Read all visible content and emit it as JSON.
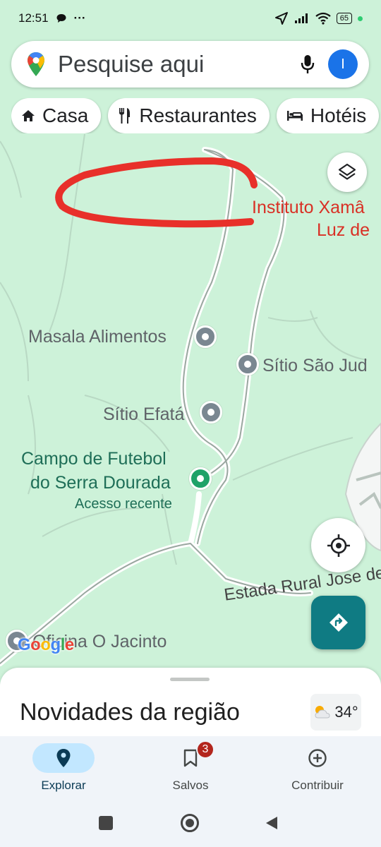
{
  "status_bar": {
    "time": "12:51",
    "dots": "···",
    "battery": "65"
  },
  "search": {
    "placeholder": "Pesquise aqui",
    "avatar_letter": "I"
  },
  "chips": [
    {
      "label": "Casa",
      "icon": "home-icon"
    },
    {
      "label": "Restaurantes",
      "icon": "restaurant-icon"
    },
    {
      "label": "Hotéis",
      "icon": "hotel-icon"
    }
  ],
  "map": {
    "places": [
      {
        "name_line1": "Instituto Xamâ",
        "name_line2": "Luz de"
      },
      {
        "name": "Masala Alimentos"
      },
      {
        "name": "Sítio São Jud"
      },
      {
        "name": "Sítio Efatá"
      },
      {
        "name_line1": "Campo de Futebol",
        "name_line2": "do Serra Dourada",
        "sub": "Acesso recente"
      },
      {
        "name": "Oficina O Jacinto"
      }
    ],
    "road_label": "Estada Rural Jose de",
    "logo": "Google",
    "annotation_color": "#e8302a"
  },
  "sheet": {
    "title": "Novidades da região",
    "temperature": "34°",
    "weather_icon": "partly-cloudy-icon"
  },
  "nav": {
    "items": [
      {
        "label": "Explorar",
        "icon": "location-pin-icon",
        "active": true
      },
      {
        "label": "Salvos",
        "icon": "bookmark-icon",
        "badge": "3"
      },
      {
        "label": "Contribuir",
        "icon": "add-circle-icon"
      }
    ]
  },
  "colors": {
    "map_bg": "#cdf2d9",
    "accent": "#1a73e8",
    "directions": "#0f7b83",
    "place_red": "#d93025",
    "place_green": "#1e6e57"
  }
}
